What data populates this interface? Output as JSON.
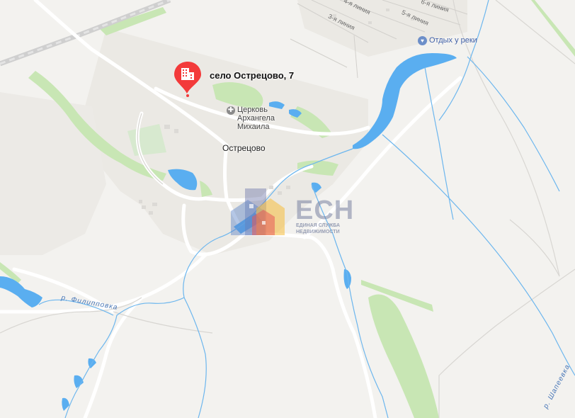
{
  "map": {
    "marker": {
      "label": "село Острецово, 7",
      "icon": "building-icon",
      "color": "#f33a3a"
    },
    "place_labels": {
      "village": "Острецово",
      "church_line1": "Церковь",
      "church_line2": "Архангела",
      "church_line3": "Михаила",
      "poi": "Отдых у реки"
    },
    "streets": {
      "line_4": "4-я линия",
      "line_3": "3-я линия",
      "line_5": "5-я линия",
      "line_6": "6-я линия"
    },
    "rivers": {
      "filippovka": "р. Филипповка",
      "shapeevka": "р. Шапеевка"
    },
    "watermark": {
      "logo_text": "ЕСН",
      "subtitle_line1": "ЕДИНАЯ СЛУЖБА",
      "subtitle_line2": "НЕДВИЖИМОСТИ"
    },
    "colors": {
      "water": "#5aaef0",
      "park": "#c8e6b4",
      "road": "#ffffff",
      "background": "#f3f2ef"
    }
  }
}
